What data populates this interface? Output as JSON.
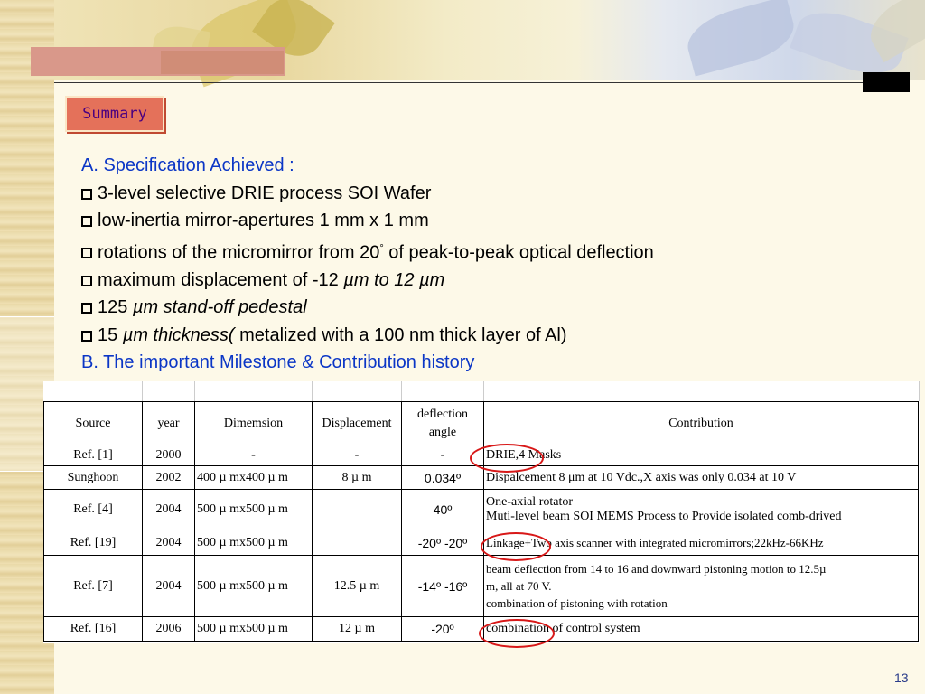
{
  "slide": {
    "heading": "Summary",
    "page_number": "13"
  },
  "content": {
    "section_a": "A. Specification Achieved :",
    "bullets": [
      {
        "pre": "3-level selective DRIE process SOI Wafer",
        "italic": "",
        "post": ""
      },
      {
        "pre": "low-inertia mirror-apertures 1 mm x 1 mm",
        "italic": "",
        "post": ""
      },
      {
        "pre": "rotations of the micromirror from  20",
        "sup": "°",
        "italic": "",
        "post": " of peak-to-peak optical deflection"
      },
      {
        "pre": "maximum displacement of -12 ",
        "italic": "µm to 12 µm",
        "post": ""
      },
      {
        "pre": "125 ",
        "italic": "µm stand-off pedestal",
        "post": ""
      },
      {
        "pre": "15 ",
        "italic": "µm thickness(",
        "post": " metalized with a 100 nm thick layer of Al)"
      }
    ],
    "section_b": "B. The important Milestone & Contribution history"
  },
  "table": {
    "headers": [
      "Source",
      "year",
      "Dimemsion",
      "Displacement",
      "deflection angle",
      "Contribution"
    ],
    "rows": [
      {
        "source": "Ref. [1]",
        "year": "2000",
        "dimension": "-",
        "displacement": "-",
        "angle": "-",
        "contribution": "DRIE,4 Masks"
      },
      {
        "source": "Sunghoon",
        "year": "2002",
        "dimension": "400 µ mx400 µ m",
        "displacement": "8  µ m",
        "angle": "0.034º",
        "contribution": "Dispalcement 8 μm at 10 Vdc.,X axis was only 0.034 at 10 V"
      },
      {
        "source": "Ref. [4]",
        "year": "2004",
        "dimension": "500 µ mx500 µ m",
        "displacement": "",
        "angle": "40º",
        "contribution_lines": [
          "One-axial rotator",
          "Muti-level beam SOI MEMS Process to Provide isolated comb-drived"
        ]
      },
      {
        "source": "Ref. [19]",
        "year": "2004",
        "dimension": "500 µ mx500 µ m",
        "displacement": "",
        "angle": "-20º -20º",
        "contribution": "Linkage+Two axis scanner with integrated micromirrors;22kHz-66KHz"
      },
      {
        "source": "Ref. [7]",
        "year": "2004",
        "dimension": "500 µ mx500 µ m",
        "displacement": "12.5 µ  m",
        "angle": "-14º -16º",
        "contribution_lines": [
          "beam deflection from 14 to 16 and downward pistoning motion to 12.5µ",
          "m, all at 70 V.",
          "combination of pistoning with rotation"
        ]
      },
      {
        "source": "Ref. [16]",
        "year": "2006",
        "dimension": "500 µ mx500 µ m",
        "displacement": "12 µ  m",
        "angle": "-20º",
        "contribution": "combination of control system"
      }
    ]
  },
  "colors": {
    "accent_blue": "#0b36c6",
    "summary_bg": "#e4715a",
    "summary_text": "#4a0080",
    "circle_red": "#d81818"
  }
}
